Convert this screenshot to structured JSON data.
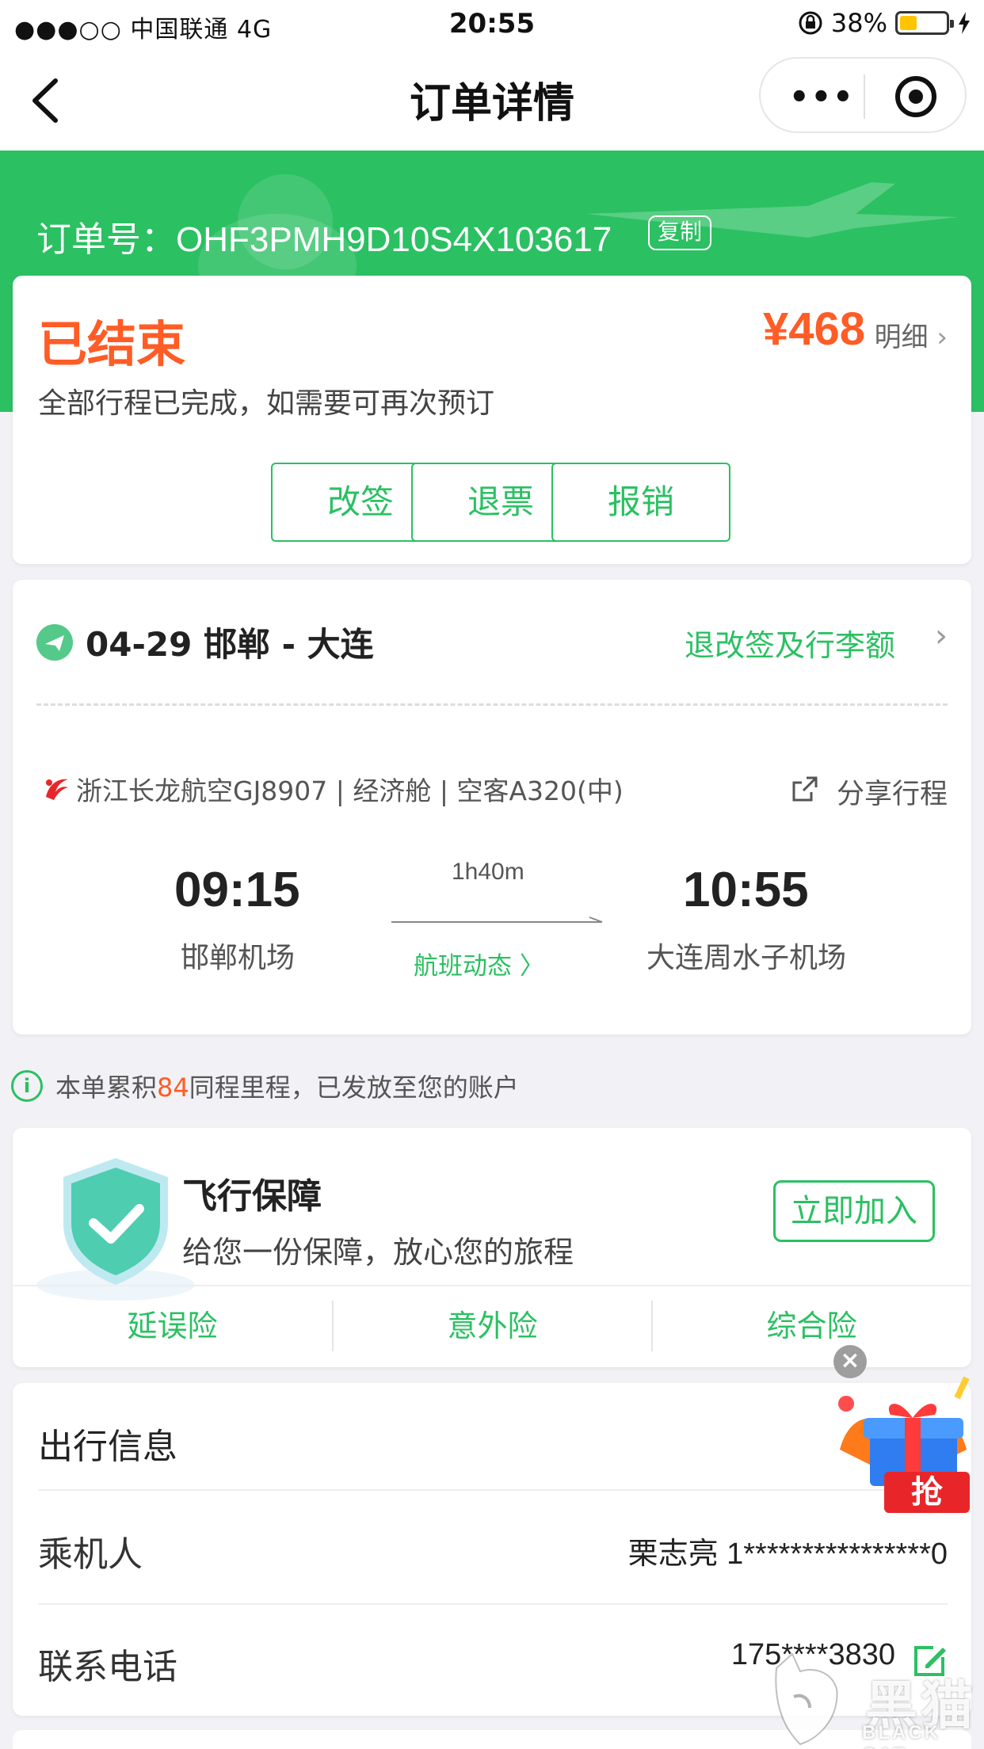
{
  "status_bar": {
    "carrier": "●●●○○ 中国联通   4G",
    "time": "20:55",
    "battery_percent": "38%",
    "battery_level": 0.38,
    "battery_color": "#ffc400"
  },
  "nav": {
    "title": "订单详情",
    "back_icon": "chevron-left-icon",
    "more_icon": "more-dots-icon",
    "close_icon": "target-circle-icon"
  },
  "header": {
    "order_label": "订单号：",
    "order_number": "OHF3PMH9D10S4X103617",
    "copy_label": "复制",
    "accent": "#2bc062"
  },
  "order_status": {
    "title": "已结束",
    "price": "¥468",
    "detail_label": "明细",
    "description": "全部行程已完成，如需要可再次预订",
    "actions": [
      "改签",
      "退票",
      "报销"
    ],
    "price_color": "#ff5c26"
  },
  "flight": {
    "route": "04-29 邯郸 - 大连",
    "rules_link": "退改签及行李额",
    "info": "浙江长龙航空GJ8907 | 经济舱 | 空客A320(中)",
    "share_label": "分享行程",
    "departure_time": "09:15",
    "departure_airport": "邯郸机场",
    "arrival_time": "10:55",
    "arrival_airport": "大连周水子机场",
    "duration": "1h40m",
    "status_link": "航班动态 〉"
  },
  "mileage": {
    "prefix": "本单累积",
    "points": "84",
    "suffix": "同程里程，已发放至您的账户"
  },
  "insurance": {
    "title": "飞行保障",
    "description": "给您一份保障，放心您的旅程",
    "join_label": "立即加入",
    "tabs": [
      "延误险",
      "意外险",
      "综合险"
    ]
  },
  "travel_info": {
    "header": "出行信息",
    "passenger_label": "乘机人",
    "passenger_value": "栗志亮 1****************0",
    "phone_label": "联系电话",
    "phone_value": "175****3830"
  },
  "promo": {
    "close": "×",
    "label": "抢"
  },
  "watermark": {
    "text": "黑猫",
    "subtext": "BLACK CAT"
  }
}
